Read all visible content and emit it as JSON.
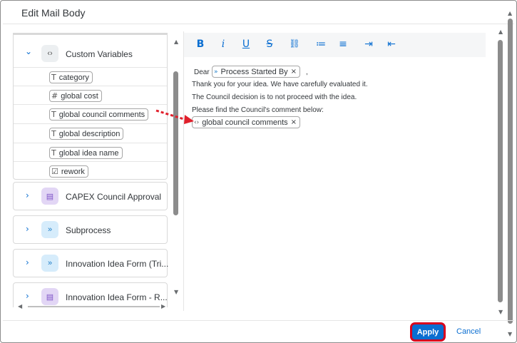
{
  "dialog": {
    "title": "Edit Mail Body"
  },
  "left": {
    "group": {
      "label": "Custom Variables",
      "icon": "code-brackets-icon",
      "variables": [
        {
          "icon": "T",
          "label": "category"
        },
        {
          "icon": "#",
          "label": "global cost"
        },
        {
          "icon": "T",
          "label": "global council comments"
        },
        {
          "icon": "T",
          "label": "global description"
        },
        {
          "icon": "T",
          "label": "global idea name"
        },
        {
          "icon": "☑",
          "label": "rework"
        }
      ]
    },
    "items": [
      {
        "label": "CAPEX Council Approval",
        "icon": "form-icon",
        "color": "#e2d6f5"
      },
      {
        "label": "Subprocess",
        "icon": "process-icon",
        "color": "#d6ecfb"
      },
      {
        "label": "Innovation Idea Form (Tri...",
        "icon": "process-icon",
        "color": "#d6ecfb"
      },
      {
        "label": "Innovation Idea Form - R...",
        "icon": "form-icon",
        "color": "#e2d6f5"
      }
    ]
  },
  "toolbar": {
    "bold": "B",
    "italic": "i",
    "underline": "U",
    "strike": "S",
    "link": "⛓",
    "ordered": "≔",
    "bullets": "≡",
    "indent": "⇥",
    "outdent": "⇤"
  },
  "editor": {
    "dear": "Dear",
    "comma": ",",
    "token_process": "Process Started By",
    "line1": "Thank you for your idea. We have carefully evaluated it.",
    "line2": "The Council decision is to not proceed with the idea.",
    "line3": "Please find the Council's comment below:",
    "token_comment": "global council comments",
    "remove_glyph": "×"
  },
  "footer": {
    "apply": "Apply",
    "cancel": "Cancel"
  }
}
